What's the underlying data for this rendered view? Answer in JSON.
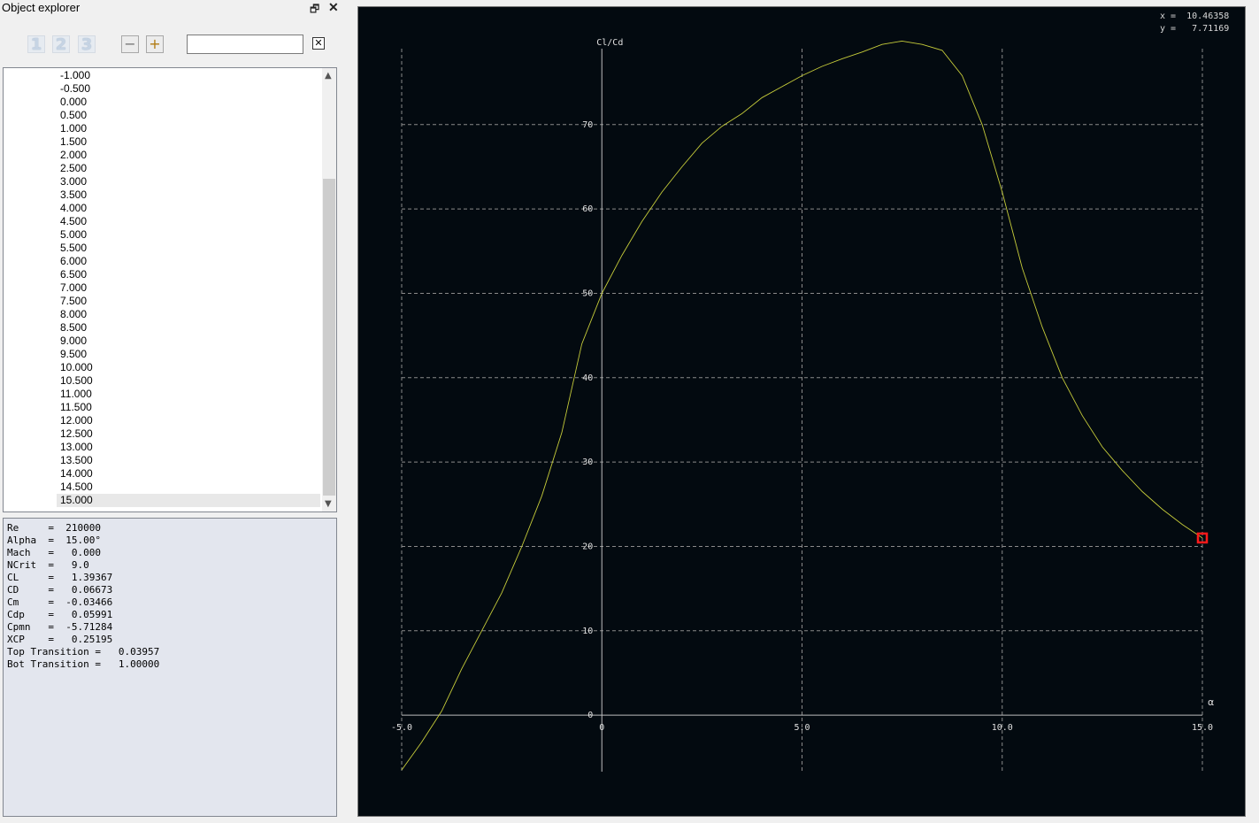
{
  "dock": {
    "title": "Object explorer",
    "float_icon": "restore-icon",
    "close_icon": "close-icon"
  },
  "toolbar": {
    "level_buttons": [
      "1",
      "2",
      "3"
    ],
    "collapse_label": "−",
    "expand_label": "+",
    "search": {
      "value": "",
      "placeholder": ""
    },
    "clear_label": "✕"
  },
  "list": {
    "items": [
      "-1.000",
      "-0.500",
      "0.000",
      "0.500",
      "1.000",
      "1.500",
      "2.000",
      "2.500",
      "3.000",
      "3.500",
      "4.000",
      "4.500",
      "5.000",
      "5.500",
      "6.000",
      "6.500",
      "7.000",
      "7.500",
      "8.000",
      "8.500",
      "9.000",
      "9.500",
      "10.000",
      "10.500",
      "11.000",
      "11.500",
      "12.000",
      "12.500",
      "13.000",
      "13.500",
      "14.000",
      "14.500",
      "15.000"
    ],
    "selected_index": 32
  },
  "properties": {
    "lines": [
      "Re     =  210000",
      "Alpha  =  15.00°",
      "Mach   =   0.000",
      "NCrit  =   9.0",
      "CL     =   1.39367",
      "CD     =   0.06673",
      "Cm     =  -0.03466",
      "Cdp    =   0.05991",
      "Cpmn   =  -5.71284",
      "XCP    =   0.25195",
      "Top Transition =   0.03957",
      "Bot Transition =   1.00000"
    ]
  },
  "graph": {
    "readout": {
      "x_label": "x =",
      "x_value": "10.46358",
      "y_label": "y =",
      "y_value": "7.71169"
    }
  },
  "chart_data": {
    "type": "line",
    "ylabel": "Cl/Cd",
    "xlabel": "α",
    "xlim": [
      -5,
      15
    ],
    "ylim": [
      -6.7,
      79
    ],
    "x_ticks": [
      -5,
      0,
      5,
      10,
      15
    ],
    "x_tick_labels": [
      "-5.0",
      "0",
      "5.0",
      "10.0",
      "15.0"
    ],
    "y_ticks": [
      0,
      10,
      20,
      30,
      40,
      50,
      60,
      70
    ],
    "y_tick_labels": [
      "0",
      "10",
      "20",
      "30",
      "40",
      "50",
      "60",
      "70"
    ],
    "grid": true,
    "colors": {
      "background": "#030a10",
      "curve": "#c6cc3a",
      "grid": "#8a8a8a",
      "marker": "#ff1a1a",
      "text": "#e0e0e0"
    },
    "series": [
      {
        "x": [
          -5.0,
          -4.5,
          -4.0,
          -3.5,
          -3.0,
          -2.5,
          -2.0,
          -1.5,
          -1.0,
          -0.5,
          0.0,
          0.5,
          1.0,
          1.5,
          2.0,
          2.5,
          3.0,
          3.5,
          4.0,
          4.5,
          5.0,
          5.5,
          6.0,
          6.5,
          7.0,
          7.5,
          8.0,
          8.5,
          9.0,
          9.5,
          10.0,
          10.5,
          11.0,
          11.5,
          12.0,
          12.5,
          13.0,
          13.5,
          14.0,
          14.5,
          15.0
        ],
        "y": [
          -6.5,
          -3.2,
          0.5,
          5.5,
          10.0,
          14.5,
          20.0,
          26.0,
          33.5,
          44.0,
          50.0,
          54.5,
          58.5,
          62.0,
          65.0,
          67.8,
          69.8,
          71.3,
          73.2,
          74.5,
          75.8,
          76.9,
          77.8,
          78.6,
          79.5,
          79.9,
          79.5,
          78.8,
          75.8,
          70.0,
          62.0,
          53.0,
          46.0,
          40.0,
          35.5,
          31.8,
          29.0,
          26.5,
          24.4,
          22.6,
          21.0
        ]
      }
    ],
    "marker_point": {
      "x": 15.0,
      "y": 21.0
    }
  }
}
